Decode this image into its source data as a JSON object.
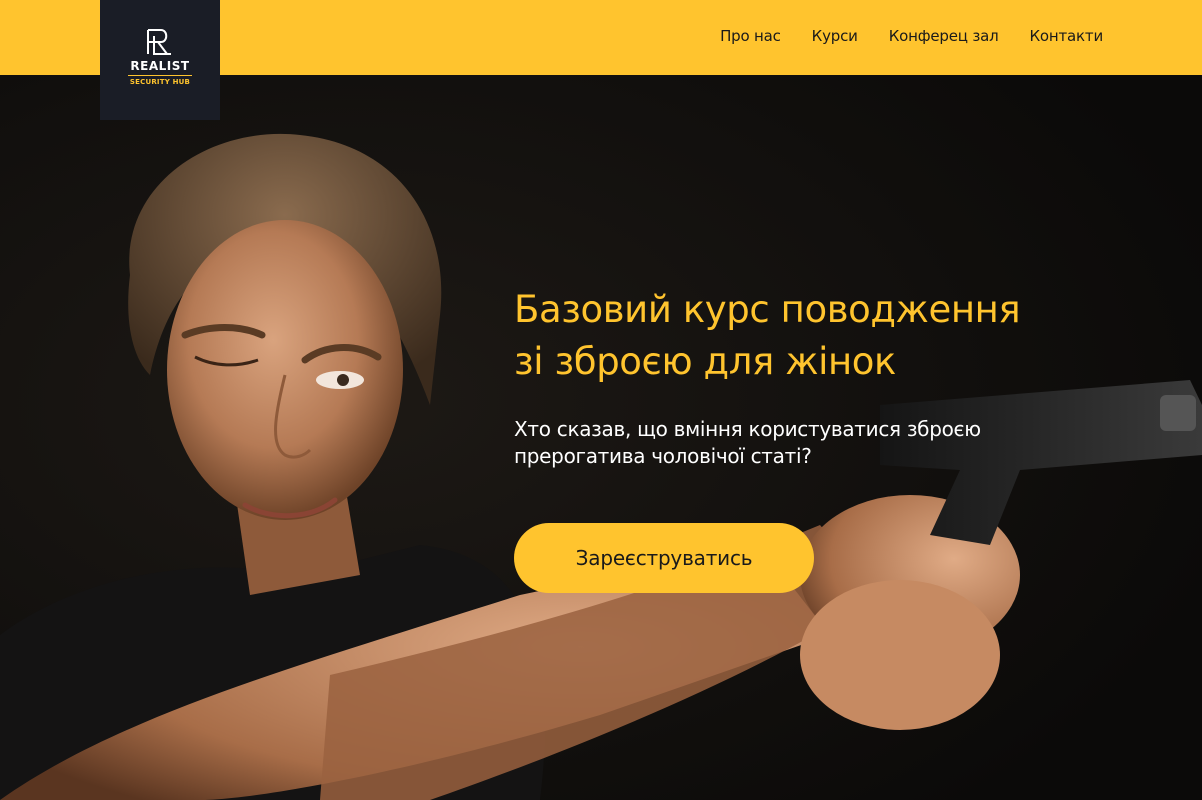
{
  "brand": {
    "name": "REALIST",
    "tagline": "SECURITY HUB",
    "accent_color": "#ffc42e",
    "dark_color": "#1a1d26"
  },
  "nav": {
    "items": [
      {
        "label": "Про нас"
      },
      {
        "label": "Курси"
      },
      {
        "label": "Конферец зал"
      },
      {
        "label": "Контакти"
      }
    ]
  },
  "hero": {
    "title_lines": [
      "Базовий курс поводження",
      "зі зброєю для жінок"
    ],
    "subtitle_lines": [
      "Хто сказав, що вміння користуватися зброєю",
      "прерогатива чоловічої статі?"
    ],
    "cta_label": "Зареєструватись",
    "image_subject": "woman-aiming-pistol"
  }
}
